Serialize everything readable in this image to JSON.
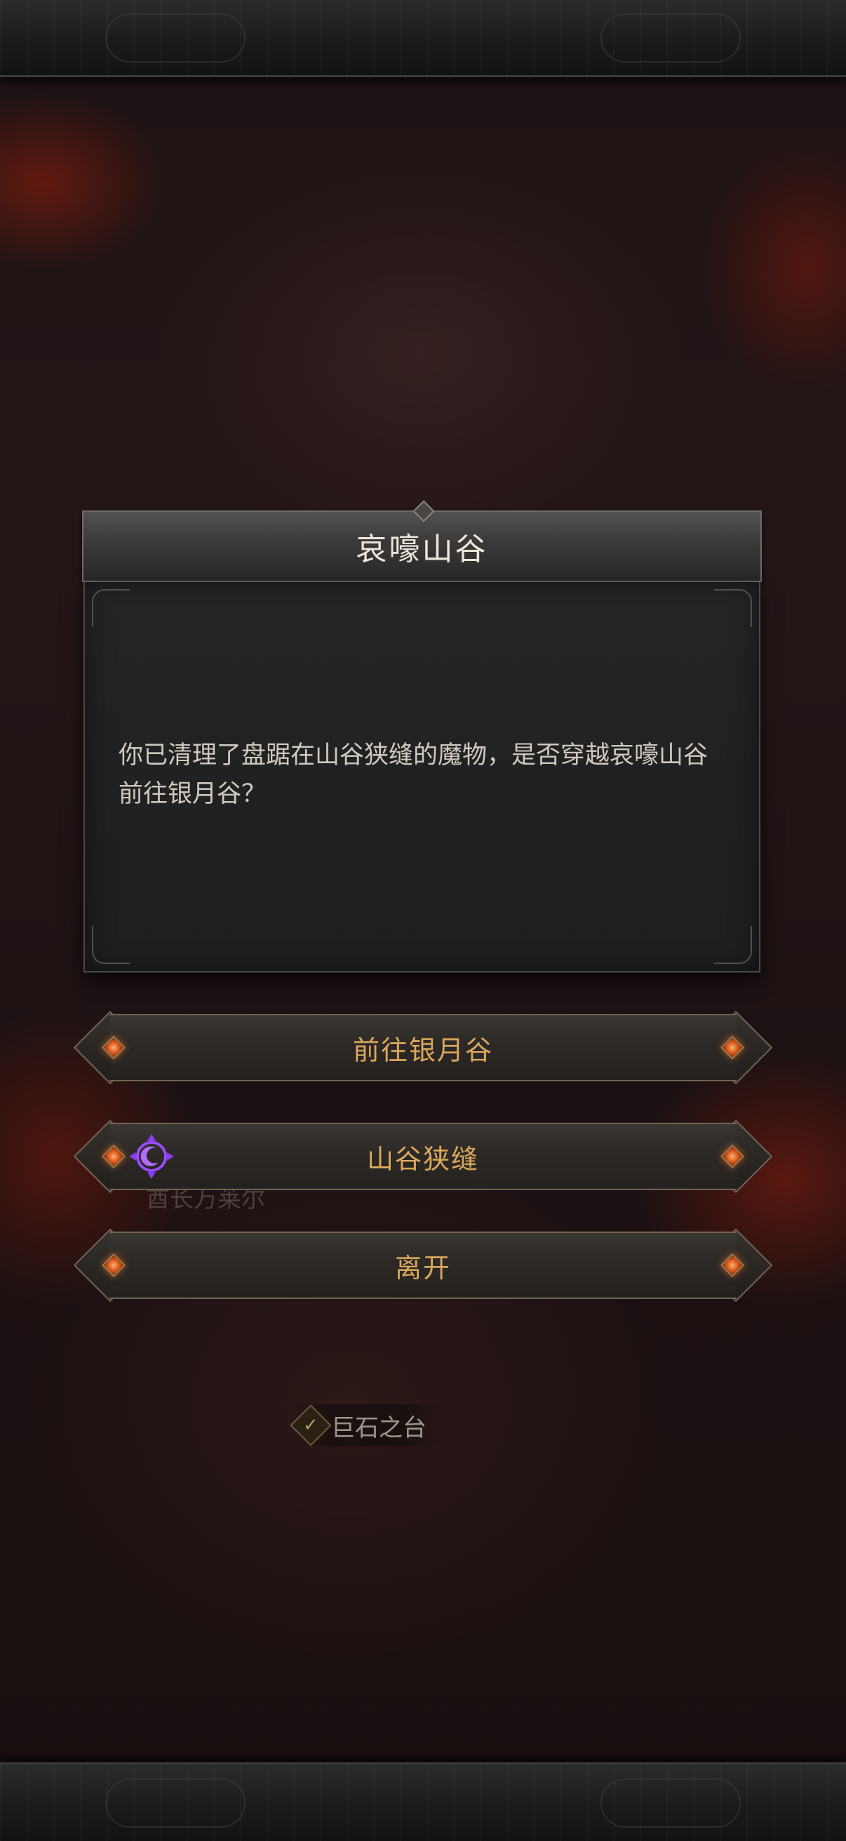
{
  "dialog": {
    "title": "哀嚎山谷",
    "message": "你已清理了盘踞在山谷狭缝的魔物，是否穿越哀嚎山谷前往银月谷？"
  },
  "options": [
    {
      "label": "前往银月谷",
      "icon": "orange-gem-icon"
    },
    {
      "label": "山谷狭缝",
      "icon": "purple-moon-rune-icon"
    },
    {
      "label": "离开",
      "icon": "orange-gem-icon"
    }
  ],
  "map": {
    "location_label": "巨石之台",
    "location_status_icon": "checkmark-icon",
    "faint_label": "酋长万莱尔"
  },
  "colors": {
    "option_text": "#d9a75c",
    "title_text": "#ece6dc",
    "gem": "#d8581c",
    "rune": "#8a3cf0"
  }
}
